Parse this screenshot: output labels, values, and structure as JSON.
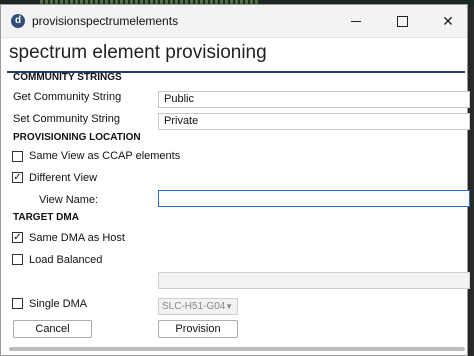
{
  "window": {
    "title": "provisionspectrumelements",
    "app_icon": "d",
    "heading": "spectrum element provisioning"
  },
  "community": {
    "section": "COMMUNITY STRINGS",
    "get_label": "Get Community String",
    "get_value": "Public",
    "set_label": "Set Community String",
    "set_value": "Private"
  },
  "location": {
    "section": "PROVISIONING LOCATION",
    "same_view_label": "Same View as CCAP elements",
    "same_view_checked": false,
    "different_view_label": "Different View",
    "different_view_checked": true,
    "view_name_label": "View Name:",
    "view_name_value": ""
  },
  "dma": {
    "section": "TARGET DMA",
    "same_dma_label": "Same DMA as Host",
    "same_dma_checked": true,
    "load_balanced_label": "Load Balanced",
    "load_balanced_checked": false,
    "load_balanced_value": "",
    "single_dma_label": "Single DMA",
    "single_dma_checked": false,
    "single_dma_selected": "SLC-H51-G04"
  },
  "buttons": {
    "cancel": "Cancel",
    "provision": "Provision"
  },
  "glyphs": {
    "check": "✓",
    "dropdown": "▼",
    "close": "✕"
  },
  "colors": {
    "accent_rule": "#1f3d6d",
    "focus_border": "#2a6fc9"
  }
}
